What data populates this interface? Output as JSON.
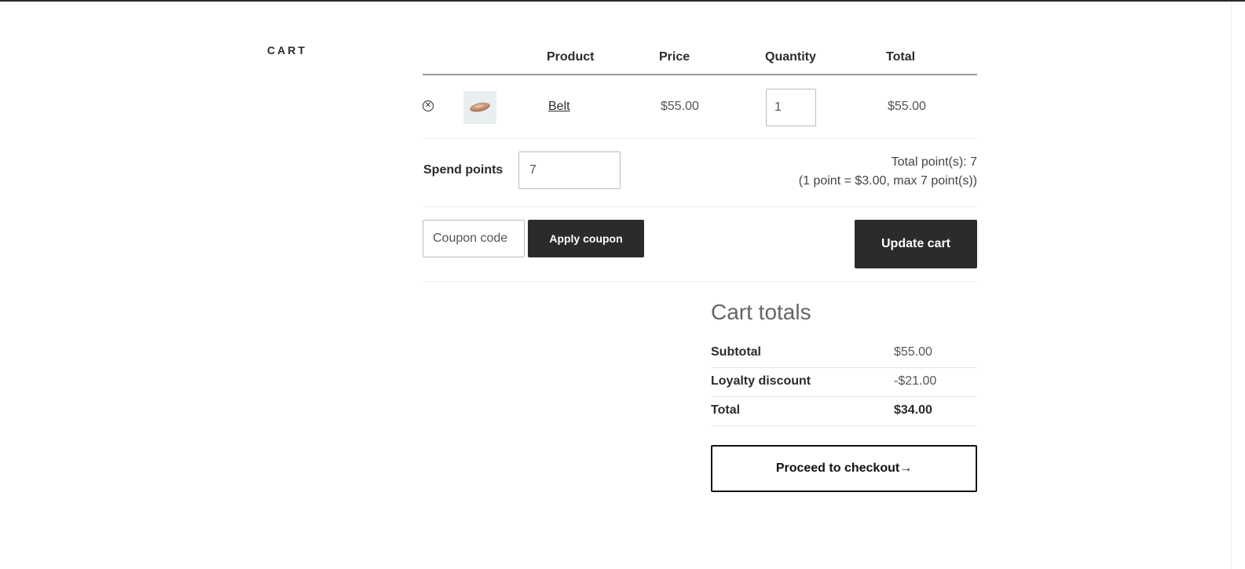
{
  "page": {
    "heading": "CART"
  },
  "cart_table": {
    "headers": {
      "product": "Product",
      "price": "Price",
      "quantity": "Quantity",
      "total": "Total"
    },
    "items": [
      {
        "remove_icon": "close-circle-icon",
        "thumbnail": "belt",
        "name": "Belt",
        "price": "$55.00",
        "quantity": "1",
        "total": "$55.00"
      }
    ]
  },
  "points": {
    "label": "Spend points",
    "value": "7",
    "total_text": "Total point(s): 7",
    "rate_text": "(1 point = $3.00, max 7 point(s))"
  },
  "coupon": {
    "placeholder": "Coupon code",
    "apply_label": "Apply coupon",
    "update_label": "Update cart"
  },
  "totals": {
    "heading": "Cart totals",
    "rows": [
      {
        "label": "Subtotal",
        "value": "$55.00"
      },
      {
        "label": "Loyalty discount",
        "value": "-$21.00"
      },
      {
        "label": "Total",
        "value": "$34.00"
      }
    ],
    "checkout_label": "Proceed to checkout→"
  },
  "colors": {
    "dark_button": "#2b2b2b",
    "text": "#2b2b2b",
    "border": "#bbbbbb"
  }
}
